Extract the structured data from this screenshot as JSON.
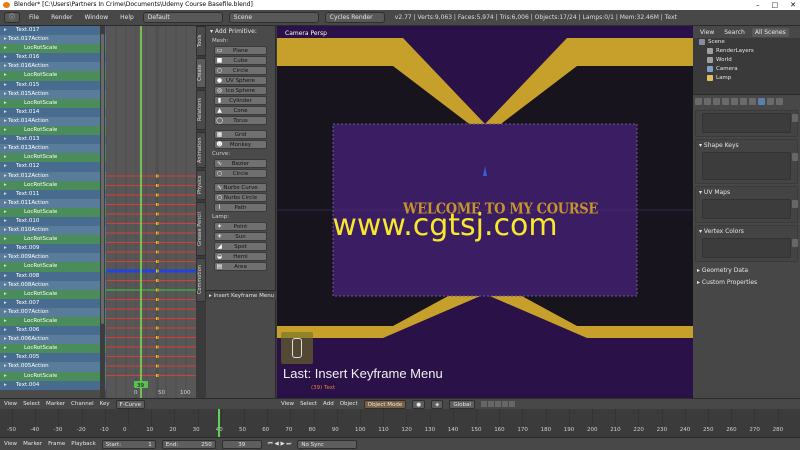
{
  "window": {
    "title": "Blender* [C:\\Users\\Partners In Crime\\Documents\\Udemy  Course  Basefile.blend]"
  },
  "infobar": {
    "menus": [
      "File",
      "Render",
      "Window",
      "Help"
    ],
    "layout": "Default",
    "scene": "Scene",
    "engine": "Cycles Render",
    "stats": "v2.77 | Verts:9,063 | Faces:5,974 | Tris:6,006 | Objects:17/24 | Lamps:0/1 | Mem:32.46M | Text"
  },
  "channels": [
    {
      "type": "obj",
      "label": "Text.017"
    },
    {
      "type": "act",
      "label": "Text.017Action"
    },
    {
      "type": "grp",
      "label": "LocRotScale"
    },
    {
      "type": "obj",
      "label": "Text.016"
    },
    {
      "type": "act",
      "label": "Text.016Action"
    },
    {
      "type": "grp",
      "label": "LocRotScale"
    },
    {
      "type": "obj",
      "label": "Text.015"
    },
    {
      "type": "act",
      "label": "Text.015Action"
    },
    {
      "type": "grp",
      "label": "LocRotScale"
    },
    {
      "type": "obj",
      "label": "Text.014"
    },
    {
      "type": "act",
      "label": "Text.014Action"
    },
    {
      "type": "grp",
      "label": "LocRotScale"
    },
    {
      "type": "obj",
      "label": "Text.013"
    },
    {
      "type": "act",
      "label": "Text.013Action"
    },
    {
      "type": "grp",
      "label": "LocRotScale"
    },
    {
      "type": "obj",
      "label": "Text.012"
    },
    {
      "type": "act",
      "label": "Text.012Action"
    },
    {
      "type": "grp",
      "label": "LocRotScale"
    },
    {
      "type": "obj",
      "label": "Text.011"
    },
    {
      "type": "act",
      "label": "Text.011Action"
    },
    {
      "type": "grp",
      "label": "LocRotScale"
    },
    {
      "type": "obj",
      "label": "Text.010"
    },
    {
      "type": "act",
      "label": "Text.010Action"
    },
    {
      "type": "grp",
      "label": "LocRotScale"
    },
    {
      "type": "obj",
      "label": "Text.009"
    },
    {
      "type": "act",
      "label": "Text.009Action"
    },
    {
      "type": "grp",
      "label": "LocRotScale"
    },
    {
      "type": "obj",
      "label": "Text.008"
    },
    {
      "type": "act",
      "label": "Text.008Action"
    },
    {
      "type": "grp",
      "label": "LocRotScale"
    },
    {
      "type": "obj",
      "label": "Text.007"
    },
    {
      "type": "act",
      "label": "Text.007Action"
    },
    {
      "type": "grp",
      "label": "LocRotScale"
    },
    {
      "type": "obj",
      "label": "Text.006"
    },
    {
      "type": "act",
      "label": "Text.006Action"
    },
    {
      "type": "grp",
      "label": "LocRotScale"
    },
    {
      "type": "obj",
      "label": "Text.005"
    },
    {
      "type": "act",
      "label": "Text.005Action"
    },
    {
      "type": "grp",
      "label": "LocRotScale"
    },
    {
      "type": "obj",
      "label": "Text.004"
    }
  ],
  "graph": {
    "ticks": [
      "0",
      "50",
      "100"
    ],
    "current_frame": "39"
  },
  "tooltabs": [
    "Tools",
    "Create",
    "Relations",
    "Animation",
    "Physics",
    "Grease Pencil",
    "Commotion"
  ],
  "toolshelf": {
    "title": "Add Primitive",
    "mesh_label": "Mesh:",
    "mesh": [
      "Plane",
      "Cube",
      "Circle",
      "UV Sphere",
      "Ico Sphere",
      "Cylinder",
      "Cone",
      "Torus"
    ],
    "mesh2": [
      "Grid",
      "Monkey"
    ],
    "curve_label": "Curve:",
    "curve": [
      "Bezier",
      "Circle"
    ],
    "curve2": [
      "Nurbs Curve",
      "Nurbs Circle",
      "Path"
    ],
    "lamp_label": "Lamp:",
    "lamp": [
      "Point",
      "Sun",
      "Spot",
      "Hemi",
      "Area"
    ],
    "redo_title": "Insert Keyframe Menu"
  },
  "viewport": {
    "label": "Camera Persp",
    "welcome_text": "WELCOME TO MY COURSE",
    "watermark": "www.cgtsj.com",
    "last_operator": "Last: Insert Keyframe Menu",
    "frame_info": "(39) Text"
  },
  "outliner": {
    "tabs": [
      "View",
      "Search",
      "All Scenes"
    ],
    "items": [
      {
        "label": "Scene",
        "color": "#8a8aa0"
      },
      {
        "label": "RenderLayers",
        "color": "#a0a0a0"
      },
      {
        "label": "World",
        "color": "#a0a0a0"
      },
      {
        "label": "Camera",
        "color": "#7fa0c8"
      },
      {
        "label": "Lamp",
        "color": "#e0c060"
      }
    ]
  },
  "properties": {
    "shape_keys": "Shape Keys",
    "uv_maps": "UV Maps",
    "vertex_colors": "Vertex Colors",
    "geometry_data": "Geometry Data",
    "custom_properties": "Custom Properties"
  },
  "ds_head": {
    "menus": [
      "View",
      "Select",
      "Marker",
      "Channel",
      "Key"
    ],
    "mode": "F-Curve"
  },
  "vp_head": {
    "menus": [
      "View",
      "Select",
      "Add",
      "Object"
    ],
    "mode": "Object Mode",
    "pivot": "Global"
  },
  "timeline": {
    "ticks": [
      "-50",
      "-40",
      "-30",
      "-20",
      "-10",
      "0",
      "10",
      "20",
      "30",
      "40",
      "50",
      "60",
      "70",
      "80",
      "90",
      "100",
      "110",
      "120",
      "130",
      "140",
      "150",
      "160",
      "170",
      "180",
      "190",
      "200",
      "210",
      "220",
      "230",
      "240",
      "250",
      "260",
      "270",
      "280"
    ],
    "current_frame": 39
  },
  "tl_head": {
    "menus": [
      "View",
      "Marker",
      "Frame",
      "Playback"
    ],
    "start": "Start:",
    "start_value": "1",
    "end": "End:",
    "end_value": "250",
    "current": "39",
    "sync": "No Sync"
  },
  "colors": {
    "accent": "#e87d0d",
    "object_row": "#486c8f",
    "group_row": "#4a8c5a",
    "gold": "#c7932a",
    "viewport_purple": "#3b1d64",
    "playhead": "#60d25a"
  }
}
